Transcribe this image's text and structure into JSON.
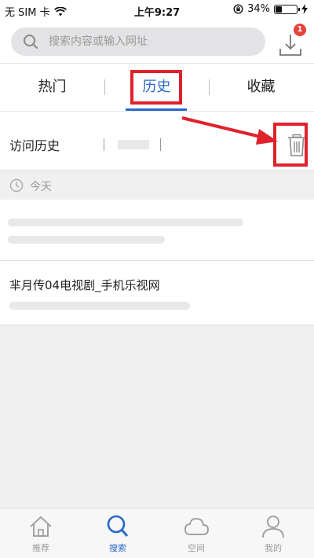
{
  "status_bar": {
    "carrier": "无 SIM 卡",
    "time": "上午9:27",
    "battery_percent": "34%",
    "battery_level": 0.34,
    "icons": [
      "wifi-icon",
      "rotation-lock-icon",
      "battery-icon",
      "charging-icon"
    ]
  },
  "search": {
    "placeholder": "搜索内容或输入网址",
    "download_badge": "1"
  },
  "tabs": [
    {
      "label": "热门"
    },
    {
      "label": "历史",
      "selected": true
    },
    {
      "label": "收藏"
    }
  ],
  "history": {
    "header_title": "访问历史",
    "date_group": "今天",
    "items": [
      {
        "title": ""
      },
      {
        "title": "芈月传04电视剧_手机乐视网"
      }
    ]
  },
  "bottom_nav": [
    {
      "label": "推荐",
      "icon": "home-icon"
    },
    {
      "label": "搜索",
      "icon": "search-icon",
      "active": true
    },
    {
      "label": "空间",
      "icon": "cloud-icon"
    },
    {
      "label": "我的",
      "icon": "person-icon"
    }
  ],
  "colors": {
    "accent": "#2a68c8",
    "annotation_red": "#e0222b",
    "badge_red": "#e8423c"
  }
}
